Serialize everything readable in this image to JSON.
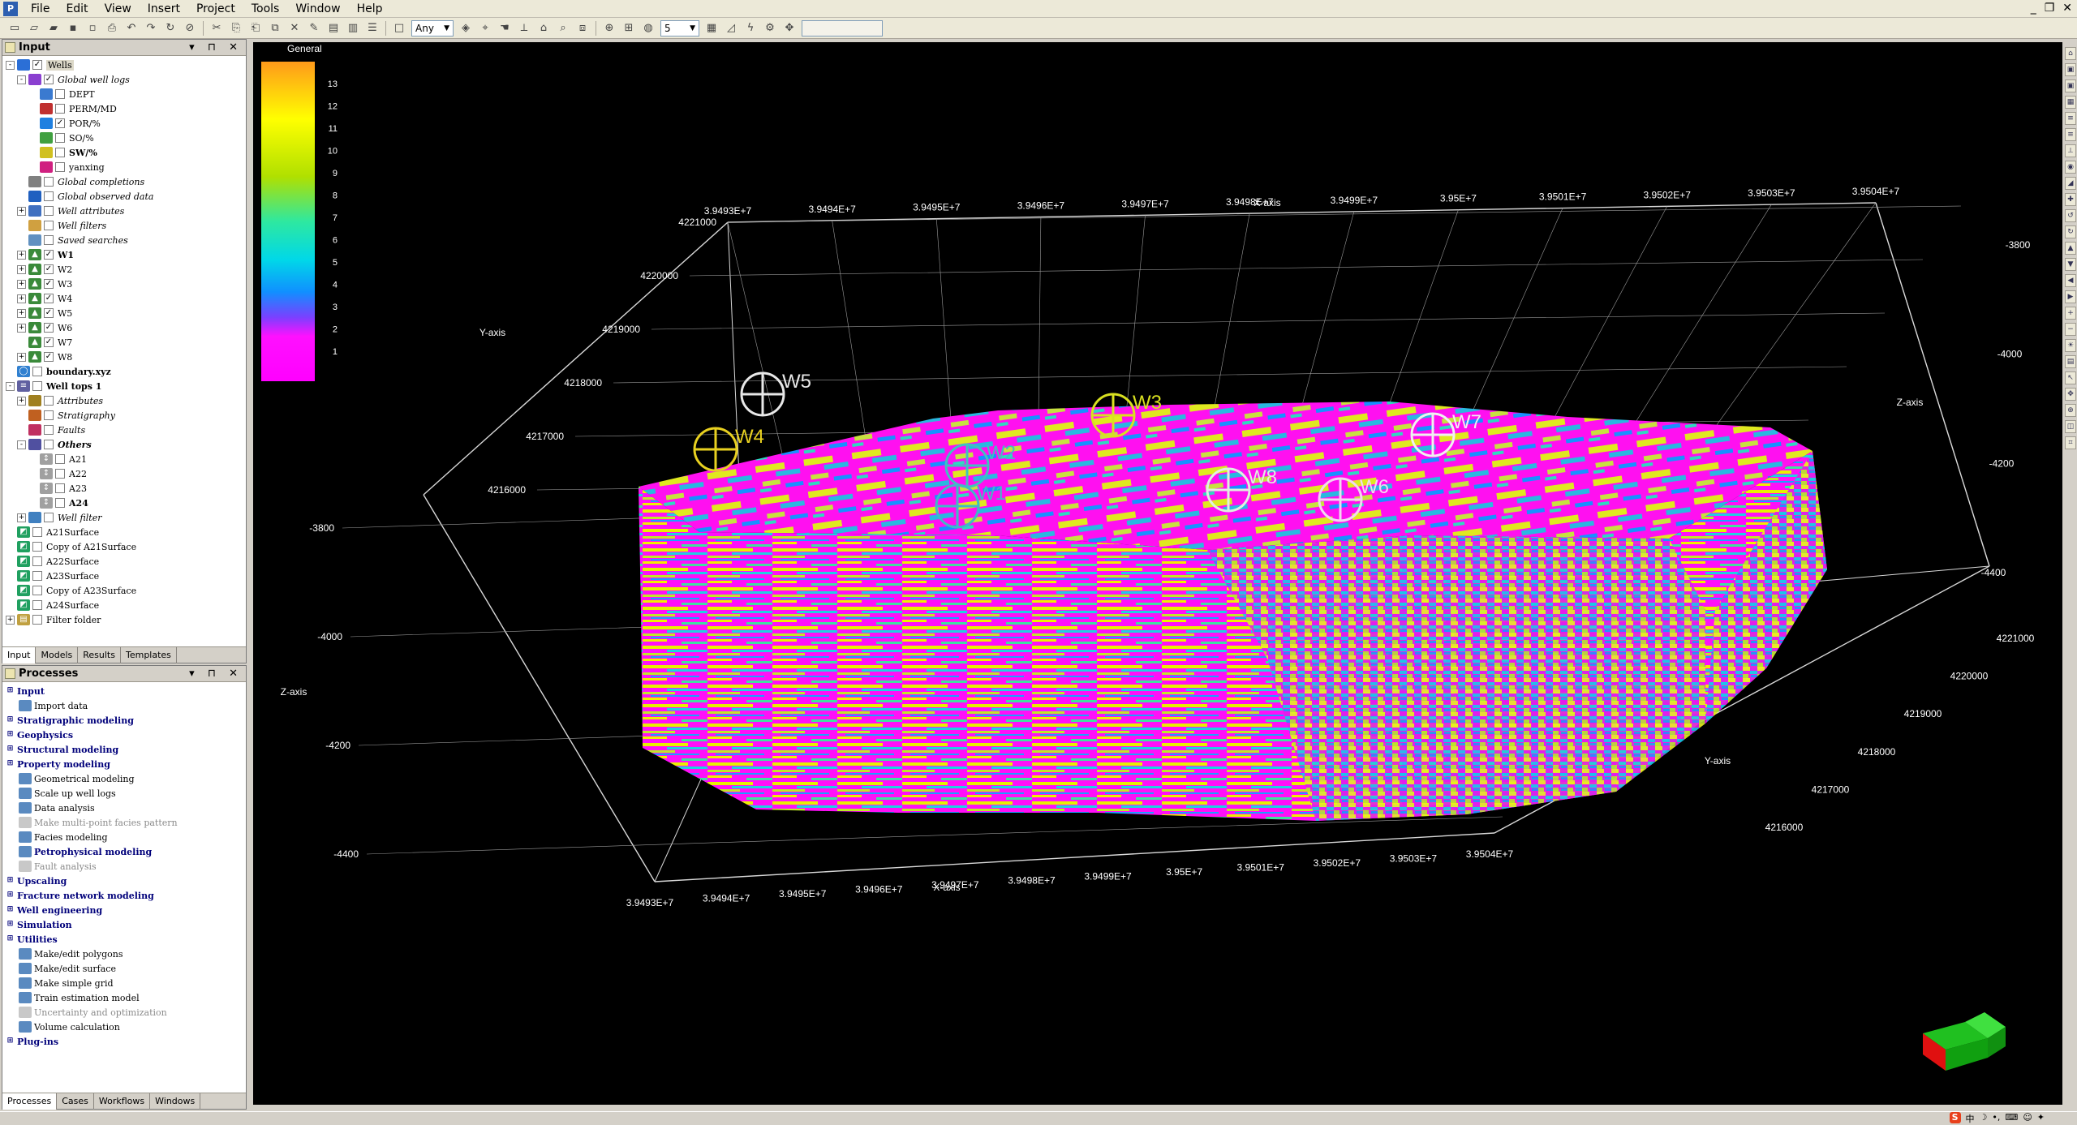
{
  "menu": [
    "File",
    "Edit",
    "View",
    "Insert",
    "Project",
    "Tools",
    "Window",
    "Help"
  ],
  "toolbar": {
    "mode_select": "Any",
    "number_select": "5"
  },
  "input_panel": {
    "title": "Input",
    "tree": [
      {
        "d": 0,
        "exp": "-",
        "icon": "wells",
        "chk": "v",
        "label": "Wells",
        "style": "normal",
        "hl": true
      },
      {
        "d": 1,
        "exp": "-",
        "icon": "logs",
        "chk": "v",
        "label": "Global well logs",
        "style": "it"
      },
      {
        "d": 2,
        "exp": "",
        "icon": "log-dept",
        "chk": "",
        "label": "DEPT",
        "style": "normal"
      },
      {
        "d": 2,
        "exp": "",
        "icon": "log-k",
        "chk": "",
        "label": "PERM/MD",
        "style": "normal"
      },
      {
        "d": 2,
        "exp": "",
        "icon": "log-por",
        "chk": "v",
        "label": "POR/%",
        "style": "normal"
      },
      {
        "d": 2,
        "exp": "",
        "icon": "log-so",
        "chk": "",
        "label": "SO/%",
        "style": "normal"
      },
      {
        "d": 2,
        "exp": "",
        "icon": "log-sw",
        "chk": "",
        "label": "SW/%",
        "style": "bold"
      },
      {
        "d": 2,
        "exp": "",
        "icon": "log-y",
        "chk": "",
        "label": "yanxing",
        "style": "normal"
      },
      {
        "d": 1,
        "exp": "",
        "icon": "compl",
        "chk": "",
        "label": "Global completions",
        "style": "it"
      },
      {
        "d": 1,
        "exp": "",
        "icon": "obs",
        "chk": "",
        "label": "Global observed data",
        "style": "it"
      },
      {
        "d": 1,
        "exp": "+",
        "icon": "attr",
        "chk": "",
        "label": "Well attributes",
        "style": "it"
      },
      {
        "d": 1,
        "exp": "",
        "icon": "filter",
        "chk": "",
        "label": "Well filters",
        "style": "it"
      },
      {
        "d": 1,
        "exp": "",
        "icon": "search",
        "chk": "",
        "label": "Saved searches",
        "style": "it"
      },
      {
        "d": 1,
        "exp": "+",
        "icon": "well",
        "chk": "v",
        "label": "W1",
        "style": "bold"
      },
      {
        "d": 1,
        "exp": "+",
        "icon": "well",
        "chk": "v",
        "label": "W2",
        "style": "normal"
      },
      {
        "d": 1,
        "exp": "+",
        "icon": "well",
        "chk": "v",
        "label": "W3",
        "style": "normal"
      },
      {
        "d": 1,
        "exp": "+",
        "icon": "well",
        "chk": "v",
        "label": "W4",
        "style": "normal"
      },
      {
        "d": 1,
        "exp": "+",
        "icon": "well",
        "chk": "v",
        "label": "W5",
        "style": "normal"
      },
      {
        "d": 1,
        "exp": "+",
        "icon": "well",
        "chk": "v",
        "label": "W6",
        "style": "normal"
      },
      {
        "d": 1,
        "exp": "",
        "icon": "well",
        "chk": "v",
        "label": "W7",
        "style": "normal"
      },
      {
        "d": 1,
        "exp": "+",
        "icon": "well",
        "chk": "v",
        "label": "W8",
        "style": "normal"
      },
      {
        "d": 0,
        "exp": "",
        "icon": "poly",
        "chk": "",
        "label": "boundary.xyz",
        "style": "bold"
      },
      {
        "d": 0,
        "exp": "-",
        "icon": "tops",
        "chk": "",
        "label": "Well tops 1",
        "style": "bold"
      },
      {
        "d": 1,
        "exp": "+",
        "icon": "attr2",
        "chk": "",
        "label": "Attributes",
        "style": "it"
      },
      {
        "d": 1,
        "exp": "",
        "icon": "strat",
        "chk": "",
        "label": "Stratigraphy",
        "style": "it"
      },
      {
        "d": 1,
        "exp": "",
        "icon": "faults",
        "chk": "",
        "label": "Faults",
        "style": "it"
      },
      {
        "d": 1,
        "exp": "-",
        "icon": "others",
        "chk": "",
        "label": "Others",
        "style": "bolditalic"
      },
      {
        "d": 2,
        "exp": "",
        "icon": "top",
        "chk": "",
        "label": "A21",
        "style": "normal"
      },
      {
        "d": 2,
        "exp": "",
        "icon": "top",
        "chk": "",
        "label": "A22",
        "style": "normal"
      },
      {
        "d": 2,
        "exp": "",
        "icon": "top",
        "chk": "",
        "label": "A23",
        "style": "normal"
      },
      {
        "d": 2,
        "exp": "",
        "icon": "top",
        "chk": "",
        "label": "A24",
        "style": "bold"
      },
      {
        "d": 1,
        "exp": "+",
        "icon": "wfilter",
        "chk": "",
        "label": "Well filter",
        "style": "it"
      },
      {
        "d": 0,
        "exp": "",
        "icon": "surf",
        "chk": "",
        "label": "A21Surface",
        "style": "normal"
      },
      {
        "d": 0,
        "exp": "",
        "icon": "surf",
        "chk": "",
        "label": "Copy of A21Surface",
        "style": "normal"
      },
      {
        "d": 0,
        "exp": "",
        "icon": "surf",
        "chk": "",
        "label": "A22Surface",
        "style": "normal"
      },
      {
        "d": 0,
        "exp": "",
        "icon": "surf",
        "chk": "",
        "label": "A23Surface",
        "style": "normal"
      },
      {
        "d": 0,
        "exp": "",
        "icon": "surf",
        "chk": "",
        "label": "Copy of A23Surface",
        "style": "normal"
      },
      {
        "d": 0,
        "exp": "",
        "icon": "surf",
        "chk": "",
        "label": "A24Surface",
        "style": "normal"
      },
      {
        "d": 0,
        "exp": "+",
        "icon": "folder",
        "chk": "",
        "label": "Filter folder",
        "style": "normal"
      }
    ],
    "tabs": [
      "Input",
      "Models",
      "Results",
      "Templates"
    ]
  },
  "processes_panel": {
    "title": "Processes",
    "rows": [
      {
        "t": "g",
        "label": "Input"
      },
      {
        "t": "i",
        "label": "Import data"
      },
      {
        "t": "g",
        "label": "Stratigraphic modeling"
      },
      {
        "t": "g",
        "label": "Geophysics"
      },
      {
        "t": "g",
        "label": "Structural modeling"
      },
      {
        "t": "g",
        "label": "Property modeling"
      },
      {
        "t": "i",
        "label": "Geometrical modeling"
      },
      {
        "t": "i",
        "label": "Scale up well logs"
      },
      {
        "t": "i",
        "label": "Data analysis"
      },
      {
        "t": "d",
        "label": "Make multi-point facies pattern"
      },
      {
        "t": "i",
        "label": "Facies modeling"
      },
      {
        "t": "b",
        "label": "Petrophysical modeling"
      },
      {
        "t": "d",
        "label": "Fault analysis"
      },
      {
        "t": "g",
        "label": "Upscaling"
      },
      {
        "t": "g",
        "label": "Fracture network modeling"
      },
      {
        "t": "g",
        "label": "Well engineering"
      },
      {
        "t": "g",
        "label": "Simulation"
      },
      {
        "t": "g",
        "label": "Utilities"
      },
      {
        "t": "i",
        "label": "Make/edit polygons"
      },
      {
        "t": "i",
        "label": "Make/edit surface"
      },
      {
        "t": "i",
        "label": "Make simple grid"
      },
      {
        "t": "i",
        "label": "Train estimation model"
      },
      {
        "t": "d",
        "label": "Uncertainty and optimization"
      },
      {
        "t": "i",
        "label": "Volume calculation"
      },
      {
        "t": "g",
        "label": "Plug-ins"
      }
    ],
    "tabs": [
      "Processes",
      "Cases",
      "Workflows",
      "Windows"
    ]
  },
  "viewer": {
    "colorbar": {
      "title": "General",
      "ticks": [
        "13",
        "12",
        "11",
        "10",
        "9",
        "8",
        "7",
        "6",
        "5",
        "4",
        "3",
        "2",
        "1"
      ]
    },
    "x_axis": {
      "label": "X-axis",
      "ticks_top": [
        "3.9493E+7",
        "3.9494E+7",
        "3.9495E+7",
        "3.9496E+7",
        "3.9497E+7",
        "3.9498E+7",
        "3.9499E+7",
        "3.95E+7",
        "3.9501E+7",
        "3.9502E+7",
        "3.9503E+7",
        "3.9504E+7"
      ],
      "ticks_bottom": [
        "3.9493E+7",
        "3.9494E+7",
        "3.9495E+7",
        "3.9496E+7",
        "3.9497E+7",
        "3.9498E+7",
        "3.9499E+7",
        "3.95E+7",
        "3.9501E+7",
        "3.9502E+7",
        "3.9503E+7",
        "3.9504E+7"
      ]
    },
    "y_axis": {
      "label": "Y-axis",
      "ticks_left": [
        "4221000",
        "4220000",
        "4219000",
        "4218000",
        "4217000",
        "4216000"
      ],
      "ticks_right": [
        "4221000",
        "4220000",
        "4219000",
        "4218000",
        "4217000",
        "4216000"
      ]
    },
    "z_axis": {
      "label": "Z-axis",
      "ticks_left": [
        "-3800",
        "-4000",
        "-4200",
        "-4400"
      ],
      "ticks_right": [
        "-3800",
        "-4000",
        "-4200",
        "-4400"
      ]
    },
    "wells": [
      {
        "name": "W5",
        "color": "#e8e8e8"
      },
      {
        "name": "W4",
        "color": "#e8d020"
      },
      {
        "name": "W3",
        "color": "#d8e020"
      },
      {
        "name": "W2",
        "color": "#40c0c0"
      },
      {
        "name": "W1",
        "color": "#40b8c8"
      },
      {
        "name": "W8",
        "color": "#e0f0e0"
      },
      {
        "name": "W6",
        "color": "#f0d8f0"
      },
      {
        "name": "W7",
        "color": "#f0f0f0"
      }
    ]
  }
}
